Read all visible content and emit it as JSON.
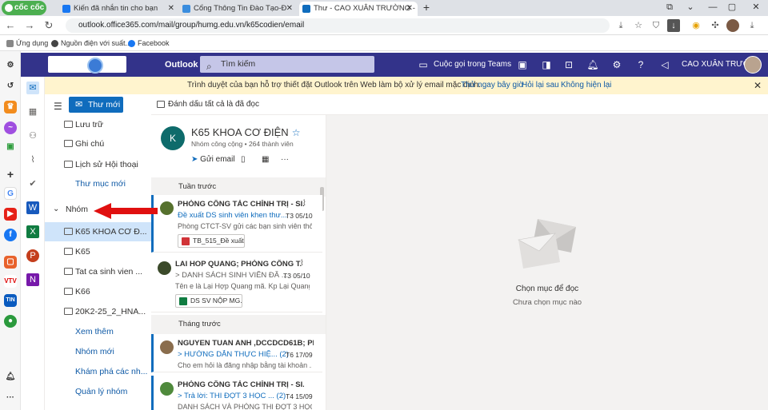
{
  "browser": {
    "brand": "cốc cốc",
    "tabs": [
      {
        "title": "Kiến đã nhắn tin cho bạn",
        "color": "#1877f2"
      },
      {
        "title": "Cổng Thông Tin Đào Tạo-Đ",
        "color": "#3a8dde"
      },
      {
        "title": "Thư - CAO XUÂN TRƯỜNG -",
        "color": "#0f6cbd"
      }
    ],
    "new_tab": "+",
    "url": "outlook.office365.com/mail/group/humg.edu.vn/k65codien/email",
    "bookmarks": [
      "Ứng dụng",
      "Nguồn điện với suất...",
      "Facebook"
    ]
  },
  "outlook": {
    "app_name": "Outlook",
    "search_placeholder": "Tìm kiếm",
    "teams_call": "Cuộc gọi trong Teams",
    "user_name": "CAO XUÂN TRƯỜ...",
    "banner": {
      "message": "Trình duyệt của bạn hỗ trợ thiết đặt Outlook trên Web làm bộ xử lý email mặc định.",
      "try_now": "Thử ngay bây giờ",
      "ask_later": "Hỏi lại sau",
      "not_show": "Không hiện lại"
    },
    "new_mail": "Thư mới",
    "mark_all_read": "Đánh dấu tất cả là đã đọc",
    "nav": {
      "folders": [
        "Lưu trữ",
        "Ghi chú",
        "Lịch sử Hội thoại"
      ],
      "new_folder": "Thư mục mới",
      "groups_header": "Nhóm",
      "groups": [
        "K65 KHOA CƠ Đ...",
        "K65",
        "Tat ca sinh vien ...",
        "K66",
        "20K2-25_2_HNA..."
      ],
      "see_more": "Xem thêm",
      "new_group": "Nhóm mới",
      "discover": "Khám phá các nh...",
      "manage": "Quản lý nhóm"
    },
    "group": {
      "initial": "K",
      "name": "K65 KHOA CƠ ĐIỆN",
      "meta": "Nhóm công cộng • 264 thành viên",
      "send_email": "Gửi email",
      "more": "···"
    },
    "sections": [
      "Tuần trước",
      "Tháng trước"
    ],
    "messages": [
      {
        "sender": "PHÒNG CÔNG TÁC CHÍNH TRỊ - SI...",
        "subject": "Đề xuất DS sinh viên khen thư...",
        "date": "T3 05/10",
        "preview": "Phòng CTCT-SV gửi các bạn sinh viên thô...",
        "attachment": "TB_515_Đề xuất...",
        "attach_color": "#d13438"
      },
      {
        "sender": "LAI HOP QUANG; PHÒNG CÔNG T...",
        "subject": "> DANH SÁCH SINH VIÊN ĐĂ ...",
        "date": "T3 05/10",
        "preview": "Tên e là Lại Hợp Quang mã. Kp Lại Quang...",
        "attachment": "DS SV NỘP MG...",
        "attach_color": "#107c41"
      },
      {
        "sender": "NGUYEN TUAN ANH ,DCCDCD61B; PH...",
        "subject": "> HƯỚNG DẪN THỰC HIỆ... (2)",
        "date": "T6 17/09",
        "preview": "Cho em hỏi là đăng nhập bằng tài khoản ..."
      },
      {
        "sender": "PHÒNG CÔNG TÁC CHÍNH TRỊ - SI...",
        "subject": "> Trả lời: THI ĐỢT 3 HỌC ... (2)",
        "date": "T4 15/09",
        "preview": "DANH SÁCH VÀ PHÒNG THI ĐỢT 3 HỌC ..."
      }
    ],
    "reading": {
      "title": "Chọn mục để đọc",
      "subtitle": "Chưa chọn mục nào"
    }
  },
  "colors": {
    "header": "#33338a",
    "accent": "#0f6cbd",
    "banner": "#fff4ce",
    "arrow": "#e01010"
  }
}
